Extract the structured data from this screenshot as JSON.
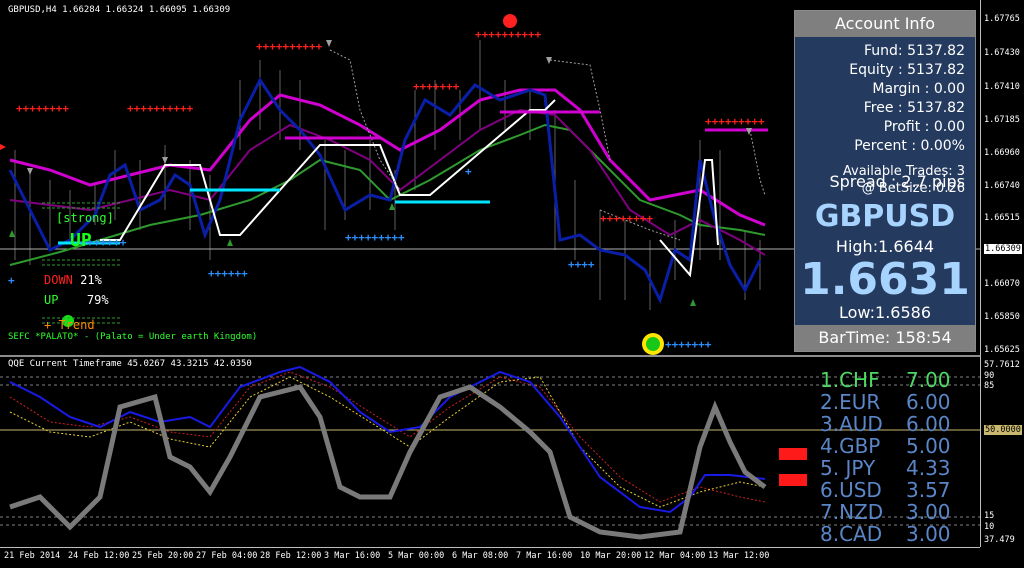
{
  "main_chart": {
    "title": "GBPUSD,H4  1.66284 1.66324 1.66095 1.66309",
    "price_labels": [
      "1.67765",
      "1.67430",
      "1.67410",
      "1.67185",
      "1.66960",
      "1.66740",
      "1.66515",
      "1.66309",
      "1.66070",
      "1.65850",
      "1.65625"
    ],
    "overlay": {
      "strong": "[strong]",
      "up_big": "UP",
      "down_label": "DOWN",
      "down_pct": "21%",
      "up_label": "UP",
      "up_pct": "79%",
      "trend": "+ Trend",
      "footer": "SEFC *PALATO* - (Palato = Under earth Kingdom)"
    }
  },
  "account": {
    "title": "Account Info",
    "fund": "Fund: 5137.82",
    "equity": "Equity : 5137.82",
    "margin": "Margin : 0.00",
    "free": "Free : 5137.82",
    "profit": "Profit : 0.00",
    "percent": "Percent : 0.00%",
    "available_trades": "Available Trades: 3",
    "betsize": "@ BetSize: 0.26",
    "spread": "Spread : 2.7 pips",
    "symbol": "GBPUSD",
    "high": "High:1.6644",
    "price": "1.6631",
    "low": "Low:1.6586",
    "bartime": "BarTime: 158:54"
  },
  "sub_chart": {
    "title": "QQE Current Timeframe 45.0267 43.3215 42.0350",
    "axis_labels": [
      "57.7612",
      "90",
      "85",
      "50.0000",
      "15",
      "10",
      "37.479"
    ]
  },
  "currency_strength": [
    {
      "rank": "1.CHF",
      "value": "7.00"
    },
    {
      "rank": "2.EUR",
      "value": "6.00"
    },
    {
      "rank": "3.AUD",
      "value": "6.00"
    },
    {
      "rank": "4.GBP",
      "value": "5.00"
    },
    {
      "rank": "5. JPY",
      "value": "4.33"
    },
    {
      "rank": "6.USD",
      "value": "3.57"
    },
    {
      "rank": "7.NZD",
      "value": "3.00"
    },
    {
      "rank": "8.CAD",
      "value": "3.00"
    }
  ],
  "time_axis": [
    "21 Feb 2014",
    "24 Feb 12:00",
    "25 Feb 20:00",
    "27 Feb 04:00",
    "28 Feb 12:00",
    "3 Mar 16:00",
    "5 Mar 00:00",
    "6 Mar 08:00",
    "7 Mar 16:00",
    "10 Mar 20:00",
    "12 Mar 04:00",
    "13 Mar 12:00"
  ],
  "colors": {
    "accent_red": "#ff2020",
    "signal_blue": "#2d8fff",
    "magenta": "#d000d0",
    "navy": "#0a1fa8",
    "green": "#2e9a2e"
  }
}
